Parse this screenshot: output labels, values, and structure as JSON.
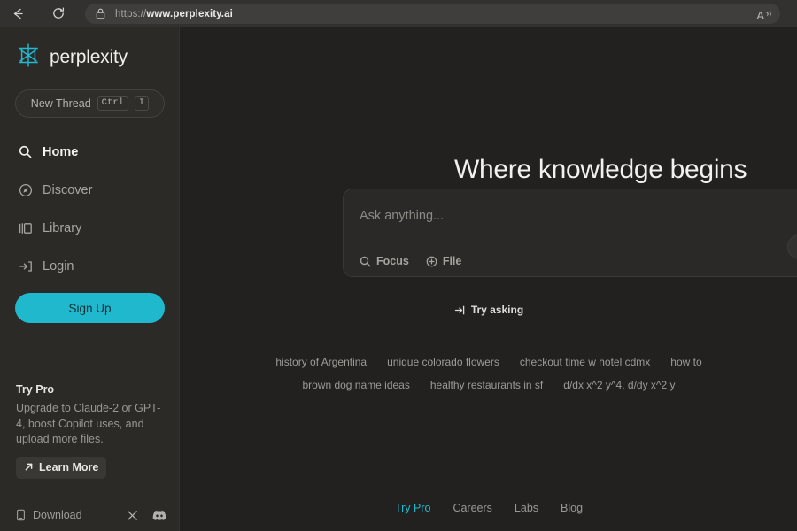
{
  "browser": {
    "back_icon": "back-arrow-icon",
    "reload_icon": "reload-icon",
    "lock_icon": "lock-icon",
    "url_prefix": "https://",
    "url_domain": "www.perplexity.ai",
    "read_aloud_icon": "read-aloud-icon",
    "read_aloud_label": "A"
  },
  "sidebar": {
    "brand": {
      "logo_icon": "perplexity-logo-icon",
      "word": "perplexity"
    },
    "new_thread": {
      "label": "New Thread",
      "key_mod": "Ctrl",
      "key_letter": "I"
    },
    "nav": [
      {
        "label": "Home",
        "icon": "search-icon",
        "active": true
      },
      {
        "label": "Discover",
        "icon": "compass-icon",
        "active": false
      },
      {
        "label": "Library",
        "icon": "library-icon",
        "active": false
      },
      {
        "label": "Login",
        "icon": "login-icon",
        "active": false
      }
    ],
    "signup_label": "Sign Up",
    "signup_color": "#20b8cd",
    "try_pro": {
      "title": "Try Pro",
      "description": "Upgrade to Claude-2 or GPT-4, boost Copilot uses, and upload more files.",
      "learn_more_label": "Learn More",
      "learn_more_icon": "arrow-up-right-icon"
    },
    "footer": {
      "download_label": "Download",
      "download_icon": "mobile-phone-icon",
      "twitter_icon": "x-twitter-icon",
      "discord_icon": "discord-icon"
    }
  },
  "main": {
    "headline": "Where knowledge begins",
    "ask_box": {
      "placeholder": "Ask anything...",
      "value": "",
      "focus_label": "Focus",
      "focus_icon": "search-icon",
      "file_label": "File",
      "file_icon": "plus-circle-icon",
      "submit_icon": "submit-knob-icon"
    },
    "try_asking": {
      "label": "Try asking",
      "icon": "arrow-into-bracket-icon"
    },
    "suggestions": [
      [
        "history of Argentina",
        "unique colorado flowers",
        "checkout time w hotel cdmx",
        "how to"
      ],
      [
        "brown dog name ideas",
        "healthy restaurants in sf",
        "d/dx x^2 y^4, d/dy x^2 y"
      ]
    ],
    "footer_links": [
      {
        "label": "Try Pro",
        "accent": true
      },
      {
        "label": "Careers",
        "accent": false
      },
      {
        "label": "Labs",
        "accent": false
      },
      {
        "label": "Blog",
        "accent": false
      }
    ]
  }
}
